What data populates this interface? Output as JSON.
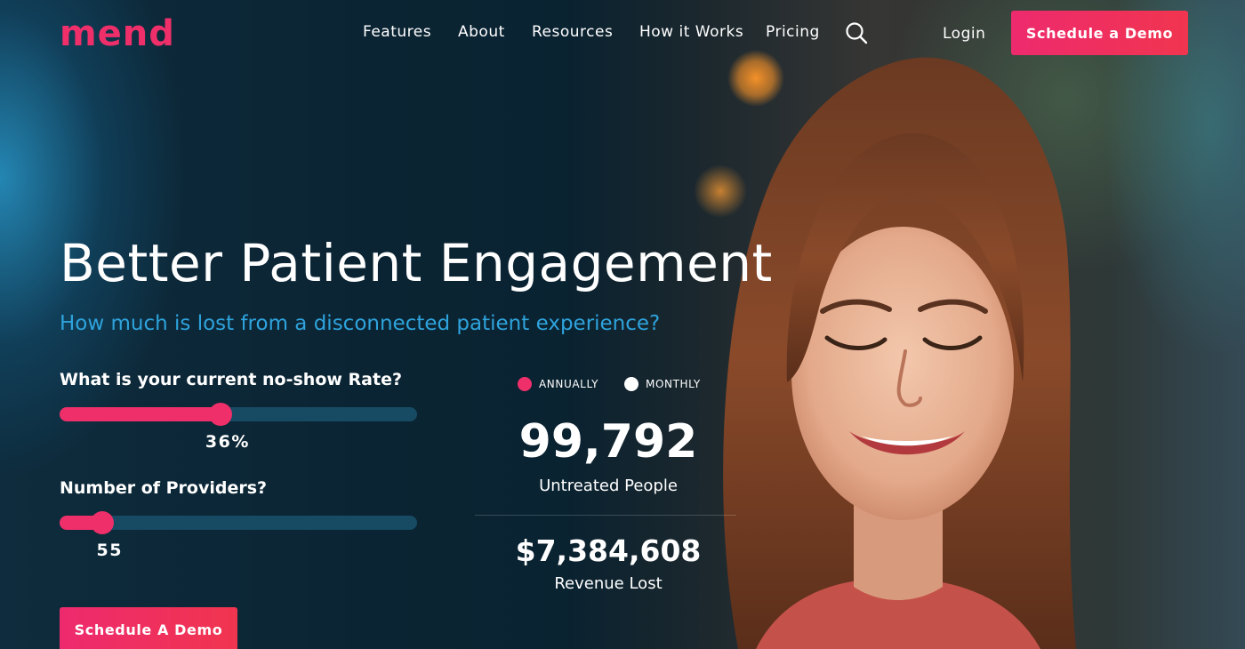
{
  "brand": {
    "logo_text": "mend",
    "accent_color": "#ee2f6a"
  },
  "nav": {
    "items": [
      {
        "label": "Features"
      },
      {
        "label": "About"
      },
      {
        "label": "Resources"
      },
      {
        "label": "How it Works"
      },
      {
        "label": "Pricing"
      }
    ],
    "search_icon": "search-icon",
    "login_label": "Login",
    "cta_label": "Schedule a Demo"
  },
  "hero": {
    "title": "Better Patient Engagement",
    "subtitle": "How much is lost from a disconnected patient experience?"
  },
  "calculator": {
    "no_show": {
      "label": "What is your current no-show Rate?",
      "value_text": "36%",
      "fraction": 0.45
    },
    "providers": {
      "label": "Number of Providers?",
      "value_text": "55",
      "fraction": 0.12
    },
    "cta_label": "Schedule A Demo"
  },
  "results": {
    "period_options": [
      {
        "label": "ANNUALLY",
        "selected": true
      },
      {
        "label": "MONTHLY",
        "selected": false
      }
    ],
    "untreated": {
      "value": "99,792",
      "label": "Untreated People"
    },
    "revenue": {
      "value": "$7,384,608",
      "label": "Revenue Lost"
    }
  }
}
